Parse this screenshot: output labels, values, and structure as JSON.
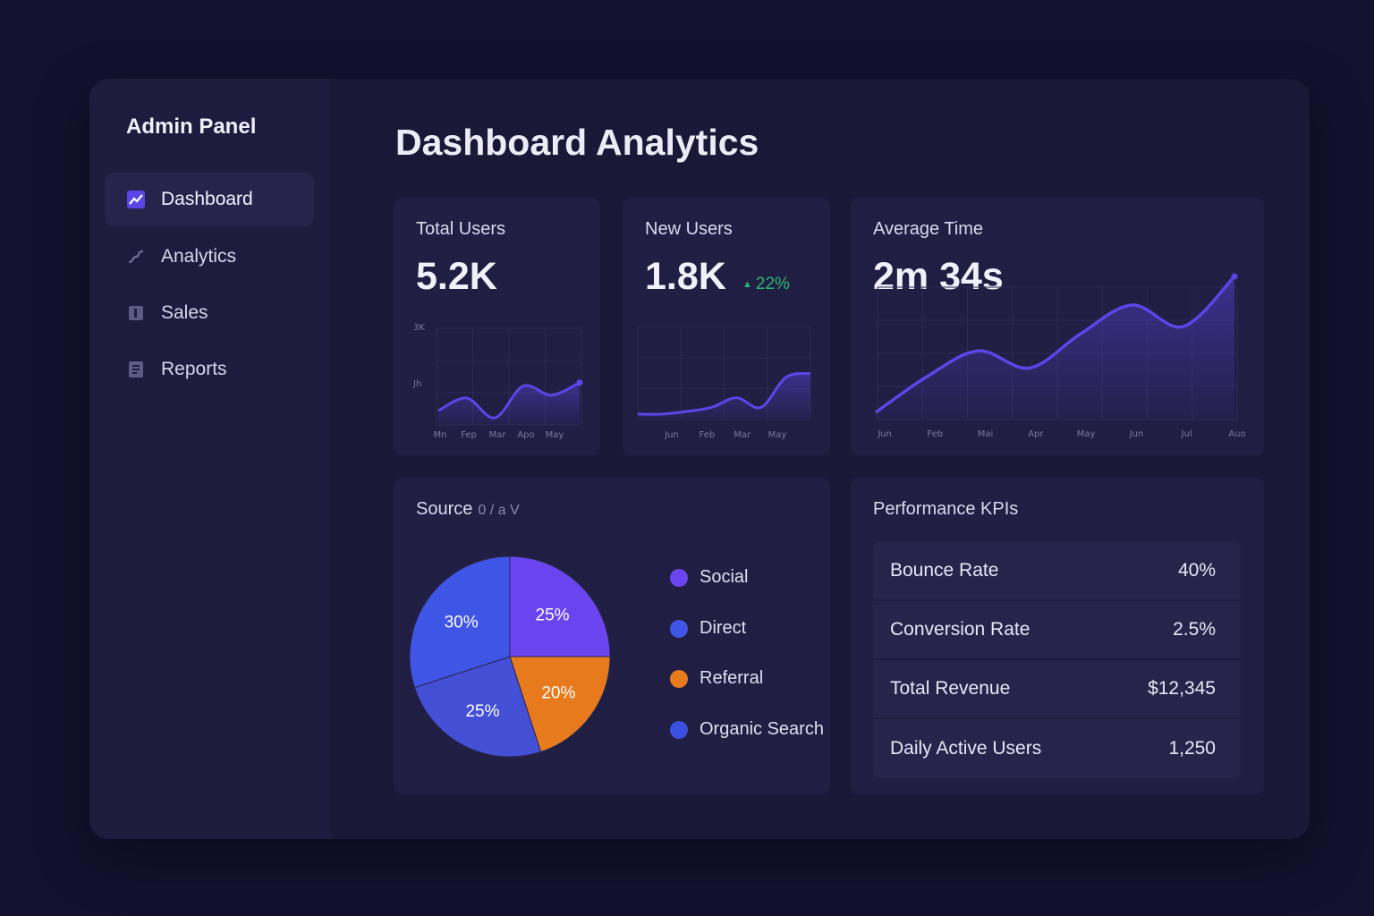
{
  "sidebar": {
    "title": "Admin Panel",
    "items": [
      {
        "label": "Dashboard",
        "icon": "dashboard-icon",
        "active": true
      },
      {
        "label": "Analytics",
        "icon": "analytics-icon",
        "active": false
      },
      {
        "label": "Sales",
        "icon": "sales-icon",
        "active": false
      },
      {
        "label": "Reports",
        "icon": "reports-icon",
        "active": false
      }
    ]
  },
  "main": {
    "title": "Dashboard Analytics"
  },
  "cards": {
    "total_users": {
      "title": "Total Users",
      "value": "5.2K"
    },
    "new_users": {
      "title": "New Users",
      "value": "1.8K",
      "delta": "22%"
    },
    "average_time": {
      "title": "Average Time",
      "value": "2m 34s"
    }
  },
  "source": {
    "title": "Source",
    "subtitle": "0 / a V"
  },
  "kpis": {
    "title": "Performance KPIs",
    "rows": [
      {
        "name": "Bounce Rate",
        "value": "40%"
      },
      {
        "name": "Conversion Rate",
        "value": "2.5%"
      },
      {
        "name": "Total Revenue",
        "value": "$12,345"
      },
      {
        "name": "Daily Active Users",
        "value": "1,250"
      }
    ]
  },
  "colors": {
    "accent": "#5b45e6",
    "positive": "#2bb673",
    "social": "#6a45ef",
    "direct": "#3f55e6",
    "referral": "#e77a1c",
    "organic": "#3b4fe0"
  },
  "chart_data": [
    {
      "type": "area",
      "y_tick_labels": [
        "3K",
        "Jh"
      ],
      "x_tick_labels": [
        "Mn",
        "Fep",
        "Mar",
        "Apo",
        "May"
      ],
      "values": [
        20,
        38,
        10,
        55,
        42,
        60
      ],
      "ylim": [
        0,
        100
      ],
      "grid": true
    },
    {
      "type": "area",
      "x_tick_labels": [
        "Jun",
        "Feb",
        "Mar",
        "May"
      ],
      "values": [
        8,
        8,
        12,
        18,
        32,
        18,
        62,
        68
      ],
      "ylim": [
        0,
        100
      ],
      "grid": true
    },
    {
      "type": "area",
      "x_tick_labels": [
        "Jun",
        "Feb",
        "Mai",
        "Apr",
        "May",
        "Jun",
        "Jul",
        "Auo"
      ],
      "values": [
        5,
        30,
        48,
        36,
        60,
        80,
        65,
        100
      ],
      "ylim": [
        0,
        100
      ],
      "grid": true
    },
    {
      "type": "pie",
      "labels": [
        "Social",
        "Direct",
        "Referral",
        "Organic Search"
      ],
      "slice_labels": [
        "25%",
        "30%",
        "20%",
        "25%"
      ],
      "order": [
        "Social",
        "Referral",
        "Organic Search",
        "Direct"
      ],
      "values_pct": [
        25,
        30,
        20,
        25
      ]
    }
  ]
}
